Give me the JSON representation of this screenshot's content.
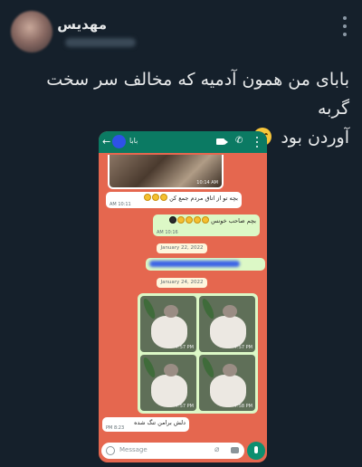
{
  "tweet": {
    "username": "مهدیس",
    "text_line1": "بابای من همون آدمیه که مخالف سر سخت گربه",
    "text_line2": "آوردن بود"
  },
  "whatsapp": {
    "contact_name": "بابا",
    "image_time": "10:14 AM",
    "msg1_text": "بچه تو از اتاق مردم جمع کن",
    "msg1_time": "10:11 AM",
    "msg2_text": "بچم صاحب خونس",
    "msg2_time": "10:16 AM",
    "date1": "January 22, 2022",
    "date2": "January 24, 2022",
    "photo_times": [
      "7:57 PM",
      "7:57 PM",
      "7:57 PM",
      "7:58 PM"
    ],
    "msg3_text": "دلش برامن تنگ شده",
    "msg3_time": "8:23 PM",
    "input_placeholder": "Message"
  }
}
